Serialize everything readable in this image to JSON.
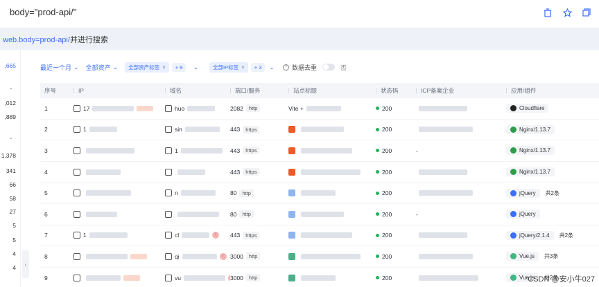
{
  "topbar": {
    "query": "body=\"prod-api/\""
  },
  "search": {
    "prefix": "web.body=prod-api/",
    "suffix": "并进行搜索"
  },
  "left": {
    "nums": [
      {
        "t": ",665",
        "blue": true
      },
      {
        "t": ",012"
      },
      {
        "t": ",889"
      },
      {
        "t": "1,378"
      },
      {
        "t": "341"
      },
      {
        "t": "66"
      },
      {
        "t": "58"
      },
      {
        "t": "27"
      },
      {
        "t": "5"
      },
      {
        "t": "5"
      },
      {
        "t": "4"
      },
      {
        "t": "4"
      }
    ]
  },
  "filters": {
    "time": "最近一个月",
    "assets": "全部资产",
    "tag1": "全部资产标签",
    "tag1_count": "+ 9",
    "tag2": "全部IP标签",
    "tag2_count": "+ 3",
    "dedup": "数据去重",
    "toggle_state": "否"
  },
  "columns": [
    "序号",
    "IP",
    "域名",
    "端口/服务",
    "站点标题",
    "状态码",
    "ICP备案企业",
    "应用/组件"
  ],
  "rows": [
    {
      "n": "1",
      "ip": "17",
      "dom": "huo",
      "port": "2082",
      "proto": "http",
      "title": "Vite +",
      "status": "200",
      "icp": "",
      "app": "Cloudflare",
      "more": "",
      "fav": "",
      "appc": "#222"
    },
    {
      "n": "2",
      "ip": "1",
      "dom": "sin",
      "port": "443",
      "proto": "https",
      "title": "",
      "status": "200",
      "icp": "",
      "app": "Nginx/1.13.7",
      "more": "",
      "fav": "orange",
      "appc": "#2e9d4a"
    },
    {
      "n": "3",
      "ip": "",
      "dom": "1",
      "port": "443",
      "proto": "https",
      "title": "",
      "status": "200",
      "icp": "-",
      "app": "Nginx/1.13.7",
      "more": "",
      "fav": "orange",
      "appc": "#2e9d4a"
    },
    {
      "n": "4",
      "ip": "",
      "dom": "",
      "port": "443",
      "proto": "https",
      "title": "",
      "status": "200",
      "icp": "",
      "app": "Nginx/1.13.7",
      "more": "",
      "fav": "orange",
      "appc": "#2e9d4a"
    },
    {
      "n": "5",
      "ip": "",
      "dom": "n",
      "port": "80",
      "proto": "http",
      "title": "",
      "status": "200",
      "icp": "",
      "app": "jQuery",
      "more": "共2条",
      "fav": "blue",
      "appc": "#3b6ff5"
    },
    {
      "n": "6",
      "ip": "",
      "dom": "",
      "port": "80",
      "proto": "http",
      "title": "",
      "status": "200",
      "icp": "-",
      "app": "jQuery",
      "more": "",
      "fav": "blue",
      "appc": "#3b6ff5"
    },
    {
      "n": "7",
      "ip": "1",
      "dom": "cl",
      "port": "443",
      "proto": "https",
      "title": "",
      "status": "200",
      "icp": "",
      "app": "jQuery/2.1.4",
      "more": "共2条",
      "fav": "blue",
      "appc": "#3b6ff5"
    },
    {
      "n": "8",
      "ip": "",
      "dom": "qi",
      "port": "3000",
      "proto": "http",
      "title": "",
      "status": "200",
      "icp": "",
      "app": "Vue.js",
      "more": "共3条",
      "fav": "green",
      "appc": "#41b883"
    },
    {
      "n": "9",
      "ip": "",
      "dom": "vu",
      "port": "3000",
      "proto": "http",
      "title": "",
      "status": "200",
      "icp": "",
      "app": "Vue.js",
      "more": "共2条",
      "fav": "green",
      "appc": "#41b883"
    }
  ],
  "watermark": "CSDN @安小牛027"
}
